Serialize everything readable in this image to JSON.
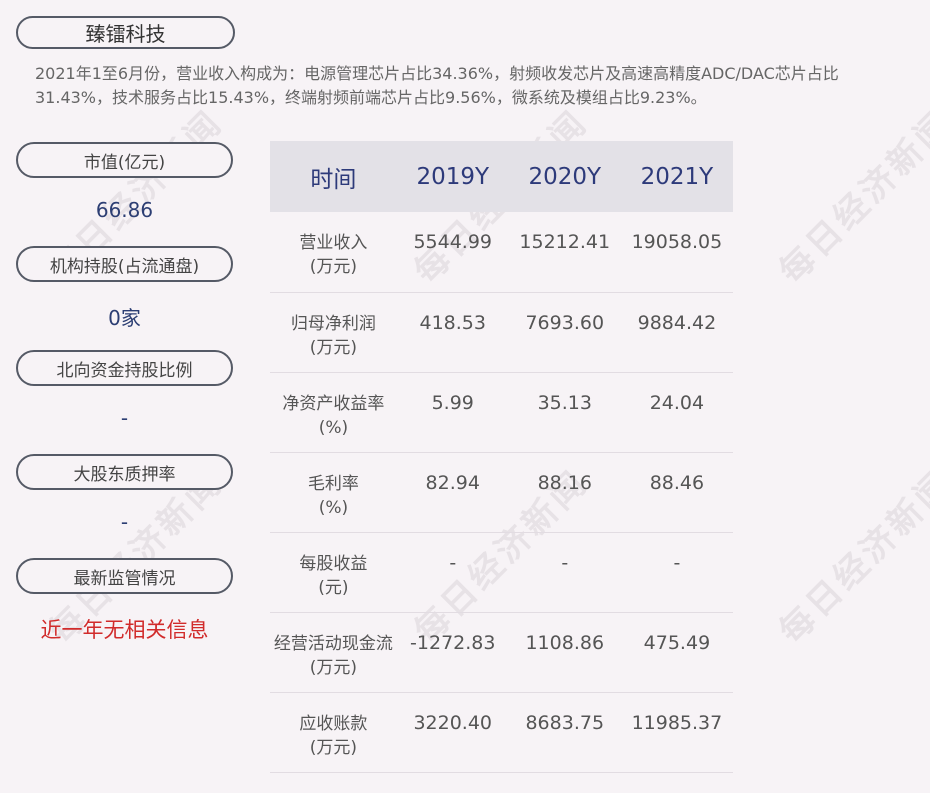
{
  "company": {
    "name": "臻镭科技"
  },
  "description": "2021年1至6月份，营业收入构成为：电源管理芯片占比34.36%，射频收发芯片及高速高精度ADC/DAC芯片占比31.43%，技术服务占比15.43%，终端射频前端芯片占比9.56%，微系统及模组占比9.23%。",
  "sidebar": {
    "market_cap_label": "市值(亿元)",
    "market_cap_value": "66.86",
    "institution_label": "机构持股(占流通盘)",
    "institution_value": "0家",
    "northbound_label": "北向资金持股比例",
    "northbound_value": "-",
    "pledge_label": "大股东质押率",
    "pledge_value": "-",
    "regulation_label": "最新监管情况",
    "regulation_value": "近一年无相关信息"
  },
  "table": {
    "headers": [
      "时间",
      "2019Y",
      "2020Y",
      "2021Y"
    ],
    "rows": [
      {
        "metric": "营业收入",
        "unit": "(万元)",
        "values": [
          "5544.99",
          "15212.41",
          "19058.05"
        ]
      },
      {
        "metric": "归母净利润",
        "unit": "(万元)",
        "values": [
          "418.53",
          "7693.60",
          "9884.42"
        ]
      },
      {
        "metric": "净资产收益率",
        "unit": "(%)",
        "values": [
          "5.99",
          "35.13",
          "24.04"
        ]
      },
      {
        "metric": "毛利率",
        "unit": "(%)",
        "values": [
          "82.94",
          "88.16",
          "88.46"
        ]
      },
      {
        "metric": "每股收益",
        "unit": "(元)",
        "values": [
          "-",
          "-",
          "-"
        ]
      },
      {
        "metric": "经营活动现金流",
        "unit": "(万元)",
        "values": [
          "-1272.83",
          "1108.86",
          "475.49"
        ]
      },
      {
        "metric": "应收账款",
        "unit": "(万元)",
        "values": [
          "3220.40",
          "8683.75",
          "11985.37"
        ]
      }
    ]
  },
  "watermark": "每日经济新闻"
}
